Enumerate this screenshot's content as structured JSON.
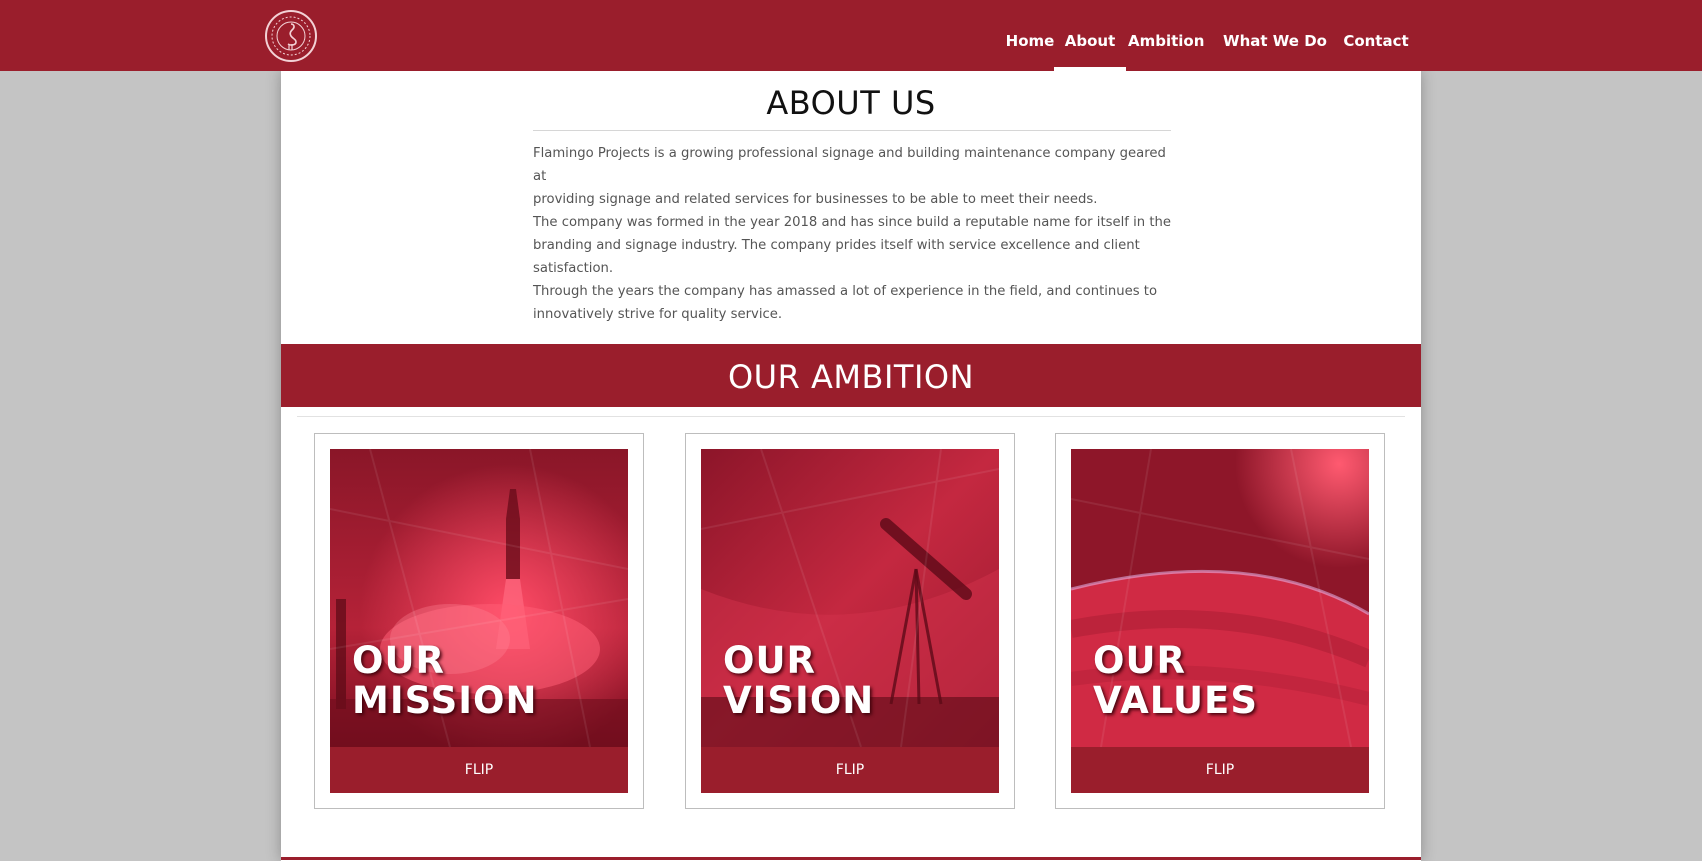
{
  "nav": {
    "logo": "flamingo-logo",
    "items": [
      {
        "label": "Home",
        "active": false
      },
      {
        "label": "About",
        "active": true
      },
      {
        "label": "Ambition",
        "active": false
      },
      {
        "label": "What We Do",
        "active": false
      },
      {
        "label": "Contact",
        "active": false
      }
    ]
  },
  "about": {
    "title": "ABOUT US",
    "paragraph1_line1": "Flamingo Projects is a growing professional signage and building maintenance company geared at",
    "paragraph1_line2": "providing signage and related services for businesses to be able to meet their needs.",
    "paragraph2_line1": "The company was formed in the year 2018 and has since build a reputable name for itself in the",
    "paragraph2_line2": "branding and signage industry. The company prides itself with service excellence and client satisfaction.",
    "paragraph2_line3": "Through the years the company has amassed a lot of experience in the field, and continues to",
    "paragraph2_line4": "innovatively strive for quality service."
  },
  "ambition": {
    "title": "OUR AMBITION",
    "cards": [
      {
        "line1": "OUR",
        "line2": "MISSION",
        "button": "FLIP",
        "image": "rocket-launch-image"
      },
      {
        "line1": "OUR",
        "line2": "VISION",
        "button": "FLIP",
        "image": "telescope-image"
      },
      {
        "line1": "OUR",
        "line2": "VALUES",
        "button": "FLIP",
        "image": "planet-horizon-image"
      }
    ]
  },
  "colors": {
    "brand": "#9a1e2c",
    "page_background": "#c4c4c4",
    "text": "#555555"
  }
}
